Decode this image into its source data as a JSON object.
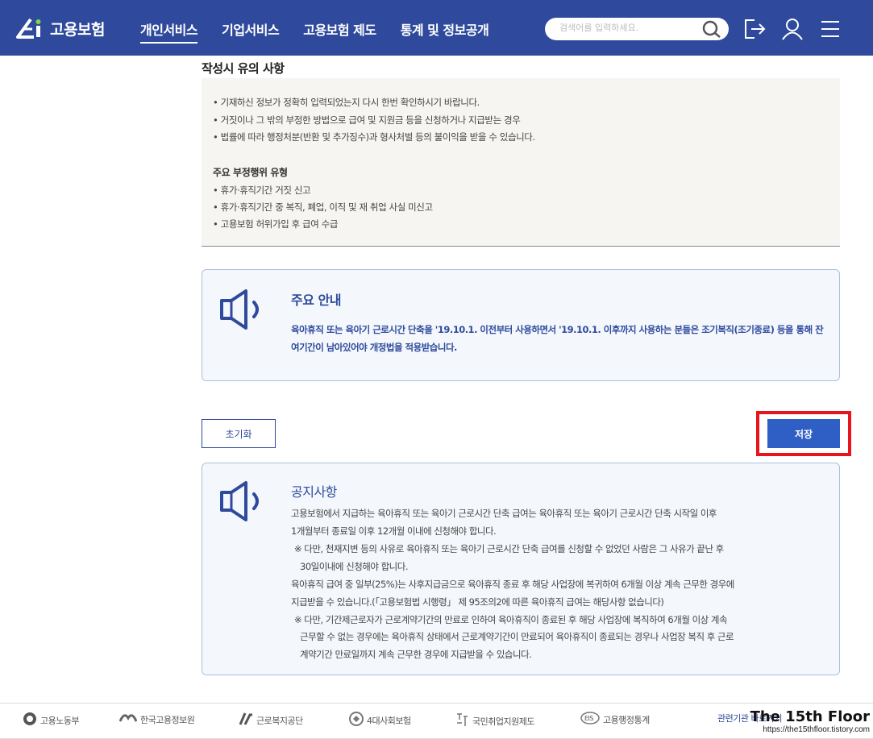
{
  "header": {
    "logo_text": "고용보험",
    "nav": [
      "개인서비스",
      "기업서비스",
      "고용보험 제도",
      "통계 및 정보공개"
    ],
    "active_nav": 0,
    "search_placeholder": "검색어를 입력하세요.",
    "icons": [
      "search-icon",
      "logout-icon",
      "user-icon",
      "menu-icon"
    ],
    "color": "#2f4a9c"
  },
  "caution": {
    "title": "작성시 유의 사항",
    "bullets": [
      "기재하신 정보가 정확히 입력되었는지 다시 한번 확인하시기 바랍니다.",
      "거짓이나 그 밖의 부정한 방법으로 급여 및 지원금 등을 신청하거나 지급받는 경우",
      "법률에 따라 행정처분(반환 및 추가징수)과 형사처벌 등의 불이익을 받을 수 있습니다."
    ],
    "sub_title": "주요 부정행위 유형",
    "sub_bullets": [
      "휴가·휴직기간 거짓 신고",
      "휴가·휴직기간 중 복직, 폐업, 이직 및 재 취업 사실 미신고",
      "고용보험 허위가입 후 급여 수급"
    ]
  },
  "notice1": {
    "title": "주요 안내",
    "text": "육아휴직 또는 육아기 근로시간 단축을 '19.10.1. 이전부터 사용하면서 '19.10.1. 이후까지 사용하는 분들은 조기복직(조기종료) 등을 통해 잔여기간이 남아있어야 개정법을 적용받습니다."
  },
  "buttons": {
    "reset": "초기화",
    "save": "저장"
  },
  "notice2": {
    "title": "공지사항",
    "lines": [
      "고용보험에서 지급하는 육아휴직 또는 육아기 근로시간 단축 급여는 육아휴직 또는 육아기 근로시간 단축 시작일 이후",
      "1개월부터 종료일 이후 12개월 이내에 신청해야 합니다.",
      "※ 다만, 천재지변 등의 사유로 육아휴직 또는 육아기 근로시간 단축 급여를 신청할 수 없었던 사람은 그 사유가 끝난 후",
      "30일이내에 신청해야 합니다.",
      "육아휴직 급여 중 일부(25%)는 사후지급금으로 육아휴직 종료 후 해당 사업장에 복귀하여 6개월 이상 계속 근무한 경우에",
      "지급받을 수 있습니다.(「고용보험법 시행령」 제 95조의2에 따른 육아휴직 급여는 해당사항 없습니다)",
      "※ 다만, 기간제근로자가 근로계약기간의 만료로 인하여 육아휴직이 종료된 후 해당 사업장에 복직하여 6개월 이상 계속",
      "근무할 수 없는 경우에는 육아휴직 상태에서 근로계약기간이 만료되어 육아휴직이 종료되는 경우나 사업장 복직 후 근로",
      "계약기간 만료일까지 계속 근무한 경우에 지급받을 수 있습니다."
    ]
  },
  "footer": {
    "links": [
      "고용노동부",
      "한국고용정보원",
      "근로복지공단",
      "4대사회보험",
      "국민취업지원제도",
      "고용행정통계",
      "관련기관 바로가기"
    ]
  },
  "watermark": {
    "title": "The 15th Floor",
    "url": "https://the15thfloor.tistory.com"
  }
}
